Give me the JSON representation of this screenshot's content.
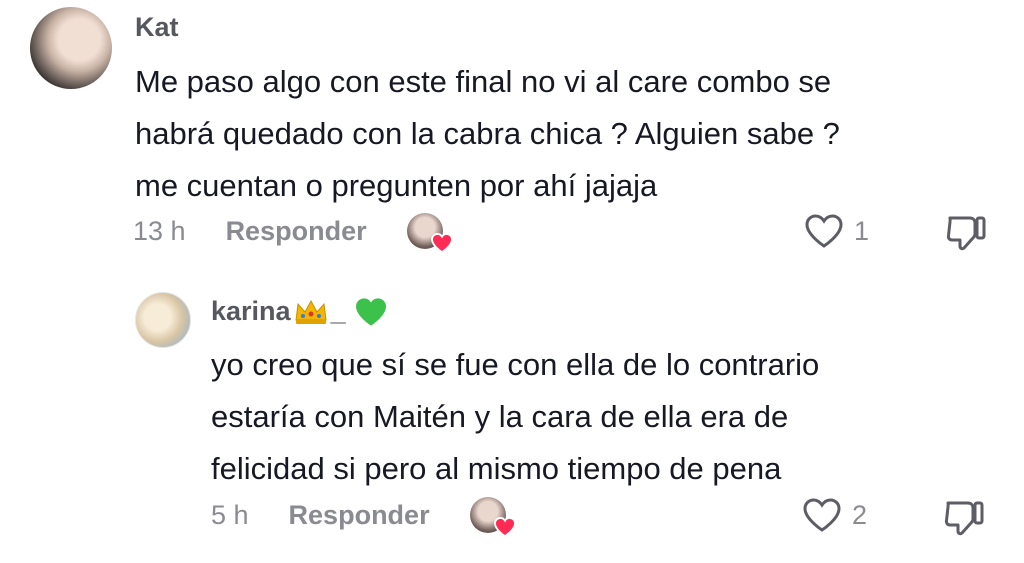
{
  "comment": {
    "username": "Kat",
    "text": "Me paso algo con este final no vi al care combo se\nhabrá quedado con la cabra chica ? Alguien sabe ?\nme cuentan o pregunten por ahí jajaja",
    "time": "13 h",
    "reply_label": "Responder",
    "likes": "1"
  },
  "reply": {
    "username_prefix": "karina",
    "username_sep": "_",
    "text": "yo creo que sí se fue con ella de lo contrario\nestaría con Maitén y la cara de ella era de\nfelicidad si pero al mismo tiempo de pena",
    "time": "5 h",
    "reply_label": "Responder",
    "likes": "2"
  },
  "colors": {
    "heart_badge": "#fe2c55",
    "green_heart": "#3cc24a",
    "crown": "#f2b600"
  },
  "icons": [
    "avatar",
    "creator-heart-icon",
    "heart-outline-icon",
    "dislike-icon",
    "crown-emoji",
    "green-heart-emoji"
  ]
}
